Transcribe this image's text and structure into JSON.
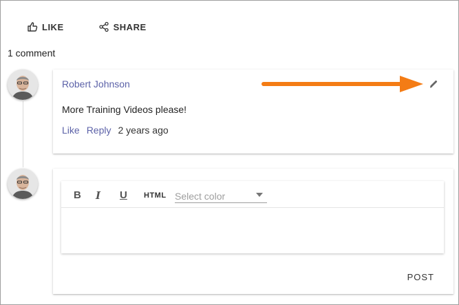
{
  "actions": {
    "like_label": "LIKE",
    "share_label": "SHARE"
  },
  "comments": {
    "count_label": "1 comment"
  },
  "comment": {
    "author": "Robert Johnson",
    "text": "More Training Videos please!",
    "like_label": "Like",
    "reply_label": "Reply",
    "timestamp": "2 years ago"
  },
  "editor": {
    "bold_label": "B",
    "italic_label": "I",
    "underline_label": "U",
    "html_label": "HTML",
    "color_placeholder": "Select color",
    "post_label": "POST"
  },
  "icons": {
    "like": "thumbs-up-icon",
    "share": "share-icon",
    "edit": "pencil-icon",
    "caret": "dropdown-caret-icon",
    "annotation": "arrow-annotation"
  },
  "colors": {
    "link": "#5c62a8",
    "arrow": "#f47c15",
    "border": "#9e9e9e"
  }
}
